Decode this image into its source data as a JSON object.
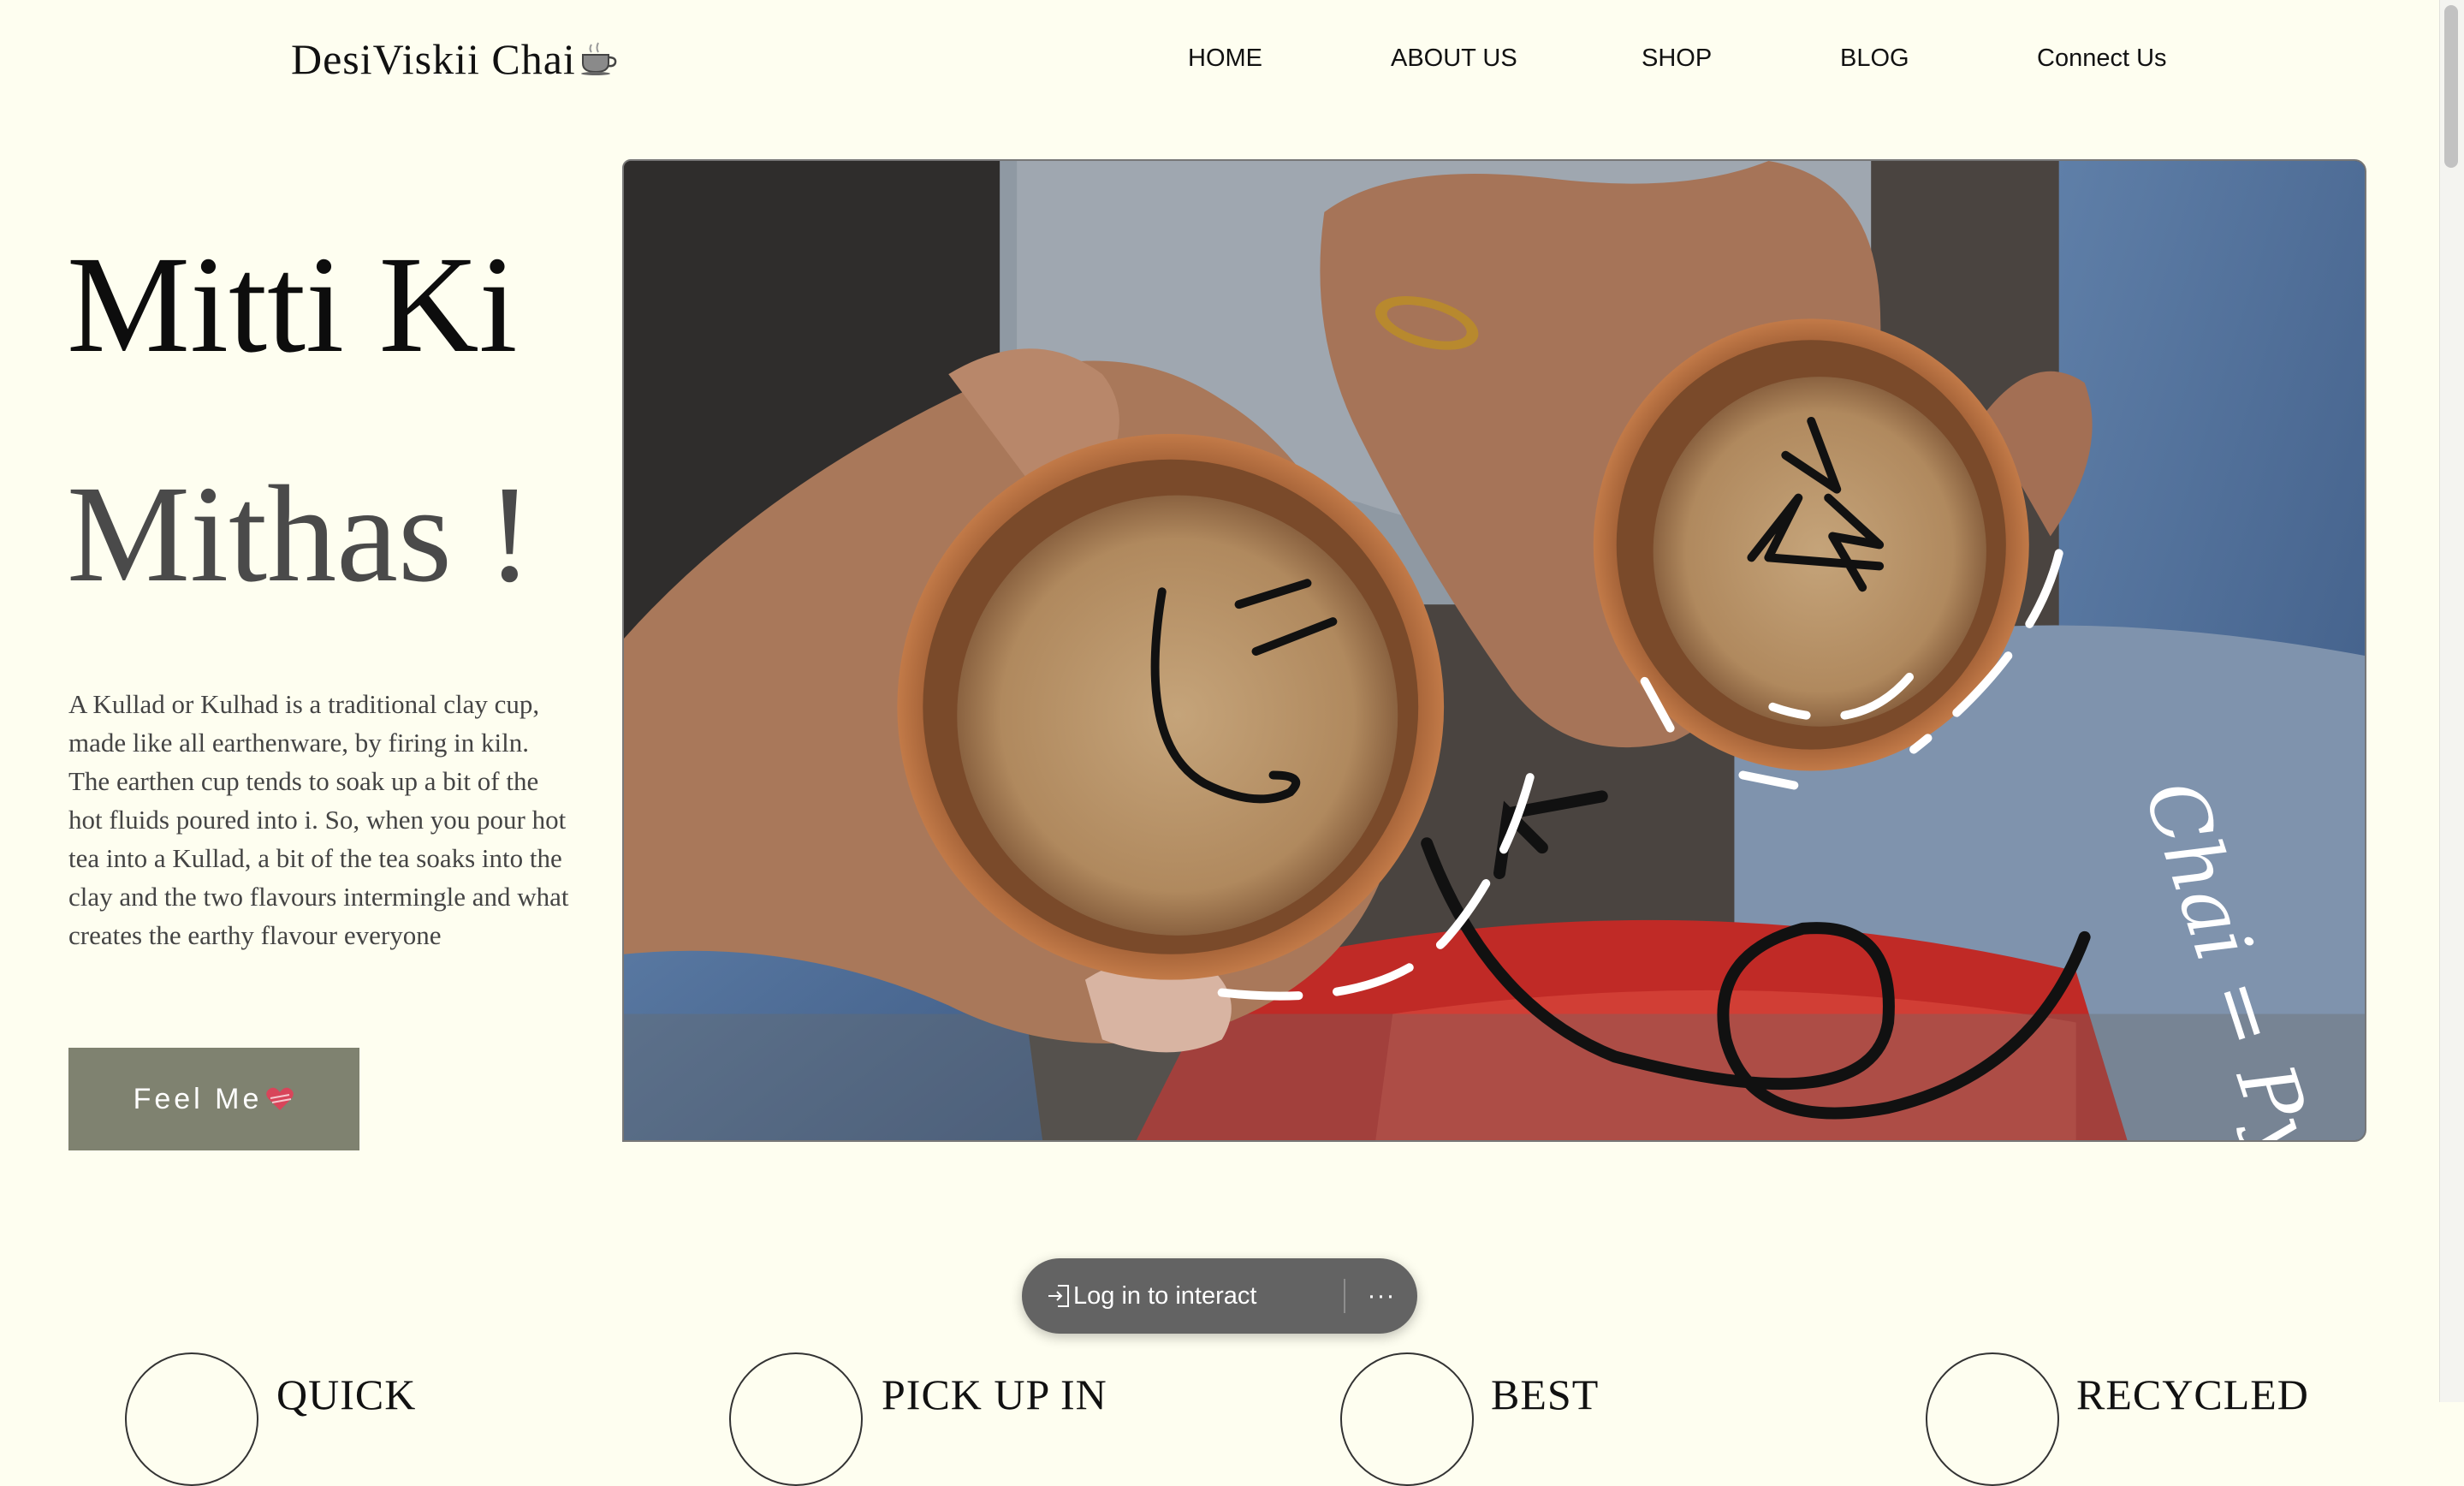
{
  "header": {
    "brand": "DesiViskii Chai",
    "brand_icon": "coffee-cup-icon",
    "nav": [
      {
        "label": "HOME"
      },
      {
        "label": "ABOUT US"
      },
      {
        "label": "SHOP"
      },
      {
        "label": "BLOG"
      },
      {
        "label": "Connect Us"
      }
    ]
  },
  "hero": {
    "title_line1": "Mitti Ki",
    "title_line2": "Mithas !",
    "description": "A Kullad or Kulhad is a traditional clay cup, made like all earthenware, by firing in kiln. The earthen cup tends to soak up a bit of the hot fluids poured into i. So, when you pour hot tea into a Kullad, a bit of the tea soaks into the clay and the two flavours intermingle and what creates the earthy flavour everyone",
    "cta_label": "Feel Me",
    "cta_icon": "heart-icon",
    "image_handwriting": "Chai = Pyaar"
  },
  "login_bar": {
    "label": "Log in to interact",
    "more_label": "···"
  },
  "features": [
    {
      "label": "QUICK"
    },
    {
      "label": "PICK UP IN"
    },
    {
      "label": "BEST"
    },
    {
      "label": "RECYCLED"
    }
  ],
  "colors": {
    "background": "#fefef0",
    "button": "#7f8270",
    "pill": "#636363"
  }
}
